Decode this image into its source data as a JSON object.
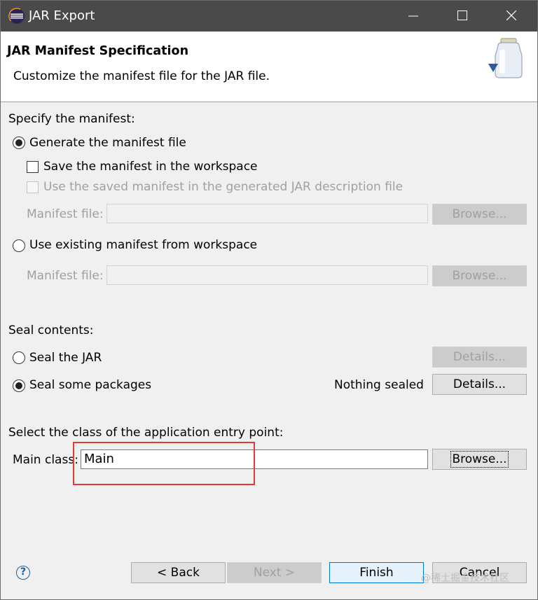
{
  "window": {
    "title": "JAR Export",
    "controls": {
      "minimize": "minimize-icon",
      "maximize": "maximize-icon",
      "close": "close-icon"
    }
  },
  "banner": {
    "title": "JAR Manifest Specification",
    "subtitle": "Customize the manifest file for the JAR file.",
    "icon": "jar-icon"
  },
  "manifest": {
    "heading": "Specify the manifest:",
    "generate_label": "Generate the manifest file",
    "generate_selected": true,
    "save_label": "Save the manifest in the workspace",
    "save_checked": false,
    "use_saved_label": "Use the saved manifest in the generated JAR description file",
    "use_saved_checked": false,
    "manifest_file_label": "Manifest file:",
    "manifest_file_value": "",
    "browse_label": "Browse...",
    "use_existing_label": "Use existing manifest from workspace",
    "use_existing_selected": false,
    "manifest_file_label_2": "Manifest file:",
    "browse_label_2": "Browse..."
  },
  "seal": {
    "heading": "Seal contents:",
    "seal_jar_label": "Seal the JAR",
    "seal_jar_selected": false,
    "details_label": "Details...",
    "seal_some_label": "Seal some packages",
    "seal_some_selected": true,
    "status": "Nothing sealed",
    "details_label_2": "Details..."
  },
  "entry": {
    "heading": "Select the class of the application entry point:",
    "main_class_label": "Main class:",
    "main_class_value": "Main",
    "browse_label": "Browse..."
  },
  "footer": {
    "help_icon": "help-icon",
    "help_glyph": "?",
    "back_label": "< Back",
    "next_label": "Next >",
    "finish_label": "Finish",
    "cancel_label": "Cancel"
  },
  "watermark": "@稀土掘金技术社区"
}
